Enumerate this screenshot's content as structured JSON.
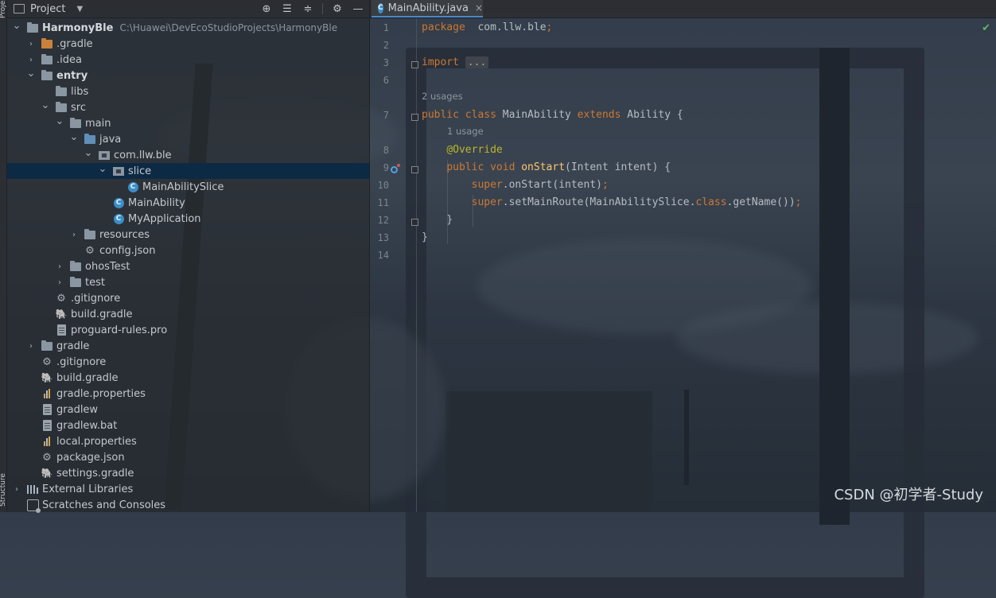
{
  "tool_strip": {
    "top_label": "Project",
    "bottom_label": "Structure"
  },
  "project_panel": {
    "title": "Project",
    "toolbar_icons": [
      "locate-icon",
      "expand-all-icon",
      "collapse-all-icon",
      "gear-icon",
      "minimize-icon"
    ],
    "tree": [
      {
        "label": "HarmonyBle",
        "path": "C:\\Huawei\\DevEcoStudioProjects\\HarmonyBle",
        "icon": "module-folder-icon",
        "depth": 0,
        "arrow": "open",
        "bold": true
      },
      {
        "label": ".gradle",
        "icon": "folder-icon",
        "color": "orange",
        "depth": 1,
        "arrow": "closed"
      },
      {
        "label": ".idea",
        "icon": "folder-icon",
        "depth": 1,
        "arrow": "closed"
      },
      {
        "label": "entry",
        "icon": "module-folder-icon",
        "depth": 1,
        "arrow": "open",
        "bold": true
      },
      {
        "label": "libs",
        "icon": "folder-icon",
        "depth": 2,
        "arrow": "none"
      },
      {
        "label": "src",
        "icon": "folder-icon",
        "depth": 2,
        "arrow": "open"
      },
      {
        "label": "main",
        "icon": "folder-icon",
        "depth": 3,
        "arrow": "open"
      },
      {
        "label": "java",
        "icon": "folder-icon",
        "color": "blue",
        "depth": 4,
        "arrow": "open"
      },
      {
        "label": "com.llw.ble",
        "icon": "package-icon",
        "depth": 5,
        "arrow": "open"
      },
      {
        "label": "slice",
        "icon": "package-icon",
        "depth": 6,
        "arrow": "open",
        "selected": true
      },
      {
        "label": "MainAbilitySlice",
        "icon": "class-icon",
        "depth": 7,
        "arrow": "none"
      },
      {
        "label": "MainAbility",
        "icon": "class-icon",
        "depth": 6,
        "arrow": "none"
      },
      {
        "label": "MyApplication",
        "icon": "class-icon",
        "depth": 6,
        "arrow": "none"
      },
      {
        "label": "resources",
        "icon": "folder-icon",
        "depth": 4,
        "arrow": "closed"
      },
      {
        "label": "config.json",
        "icon": "json-file-icon",
        "depth": 4,
        "arrow": "none"
      },
      {
        "label": "ohosTest",
        "icon": "folder-icon",
        "depth": 3,
        "arrow": "closed"
      },
      {
        "label": "test",
        "icon": "folder-icon",
        "depth": 3,
        "arrow": "closed"
      },
      {
        "label": ".gitignore",
        "icon": "gitignore-file-icon",
        "depth": 2,
        "arrow": "none"
      },
      {
        "label": "build.gradle",
        "icon": "gradle-file-icon",
        "depth": 2,
        "arrow": "none"
      },
      {
        "label": "proguard-rules.pro",
        "icon": "text-file-icon",
        "depth": 2,
        "arrow": "none"
      },
      {
        "label": "gradle",
        "icon": "folder-icon",
        "depth": 1,
        "arrow": "closed"
      },
      {
        "label": ".gitignore",
        "icon": "gitignore-file-icon",
        "depth": 1,
        "arrow": "none"
      },
      {
        "label": "build.gradle",
        "icon": "gradle-file-icon",
        "depth": 1,
        "arrow": "none"
      },
      {
        "label": "gradle.properties",
        "icon": "properties-file-icon",
        "depth": 1,
        "arrow": "none"
      },
      {
        "label": "gradlew",
        "icon": "script-file-icon",
        "depth": 1,
        "arrow": "none"
      },
      {
        "label": "gradlew.bat",
        "icon": "text-file-icon",
        "depth": 1,
        "arrow": "none"
      },
      {
        "label": "local.properties",
        "icon": "properties-file-icon",
        "depth": 1,
        "arrow": "none"
      },
      {
        "label": "package.json",
        "icon": "json-file-icon",
        "depth": 1,
        "arrow": "none"
      },
      {
        "label": "settings.gradle",
        "icon": "gradle-file-icon",
        "depth": 1,
        "arrow": "none"
      },
      {
        "label": "External Libraries",
        "icon": "libraries-icon",
        "depth": 0,
        "arrow": "closed"
      },
      {
        "label": "Scratches and Consoles",
        "icon": "scratches-icon",
        "depth": 0,
        "arrow": "none"
      }
    ]
  },
  "editor": {
    "tab_label": "MainAbility.java",
    "tab_close": "×",
    "status_check": "✔",
    "lines": [
      {
        "n": "1",
        "tokens": [
          [
            "kw",
            "package"
          ],
          [
            "",
            "  com.llw.ble"
          ],
          [
            "kw",
            ";"
          ]
        ]
      },
      {
        "n": "2",
        "tokens": []
      },
      {
        "n": "3",
        "tokens": [
          [
            "kw",
            "import"
          ],
          [
            "",
            " "
          ],
          [
            "fold",
            "..."
          ]
        ]
      },
      {
        "n": "6",
        "tokens": []
      },
      {
        "n": "7",
        "hint": "2 usages",
        "tokens": [
          [
            "kw",
            "public class"
          ],
          [
            "",
            " MainAbility "
          ],
          [
            "kw",
            "extends"
          ],
          [
            "",
            " Ability {"
          ]
        ]
      },
      {
        "n": "8",
        "hint": "1 usage",
        "tokens": [
          [
            "",
            "    "
          ],
          [
            "ann",
            "@Override"
          ]
        ]
      },
      {
        "n": "9",
        "tokens": [
          [
            "",
            "    "
          ],
          [
            "kw",
            "public void"
          ],
          [
            "",
            " "
          ],
          [
            "fn",
            "onStart"
          ],
          [
            "",
            "(Intent intent) {"
          ]
        ]
      },
      {
        "n": "10",
        "tokens": [
          [
            "",
            "        "
          ],
          [
            "sup",
            "super"
          ],
          [
            "",
            ".onStart(intent)"
          ],
          [
            "kw",
            ";"
          ]
        ]
      },
      {
        "n": "11",
        "tokens": [
          [
            "",
            "        "
          ],
          [
            "sup",
            "super"
          ],
          [
            "",
            ".setMainRoute(MainAbilitySlice."
          ],
          [
            "kw",
            "class"
          ],
          [
            "",
            ".getName())"
          ],
          [
            "kw",
            ";"
          ]
        ]
      },
      {
        "n": "12",
        "tokens": [
          [
            "",
            "    }"
          ]
        ]
      },
      {
        "n": "13",
        "tokens": [
          [
            "",
            "}"
          ]
        ]
      },
      {
        "n": "14",
        "tokens": []
      }
    ]
  },
  "watermark": "CSDN @初学者-Study"
}
